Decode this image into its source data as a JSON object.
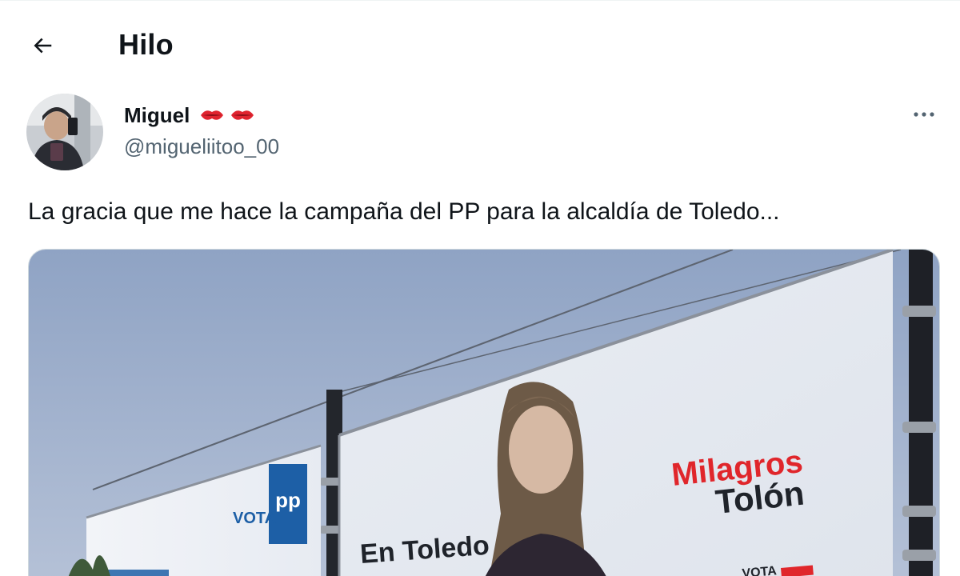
{
  "header": {
    "title": "Hilo"
  },
  "tweet": {
    "author": {
      "display_name": "Miguel",
      "name_emoji": [
        "kiss-mark-icon",
        "kiss-mark-icon"
      ],
      "handle": "@migueliitoo_00"
    },
    "text": "La gracia que me hace la campaña del PP para la alcaldía de Toledo...",
    "media": {
      "left_billboard": {
        "vota": "VOTA",
        "logo_text": "pp"
      },
      "right_billboard": {
        "tagline": "En Toledo",
        "name_line1": "Milagros",
        "name_line2": "Tolón",
        "vota": "VOTA"
      }
    }
  },
  "colors": {
    "text_primary": "#0f1419",
    "text_secondary": "#536471",
    "border": "#cfd9de",
    "pp_blue": "#1d5fa6",
    "psoe_red": "#e0262b"
  }
}
